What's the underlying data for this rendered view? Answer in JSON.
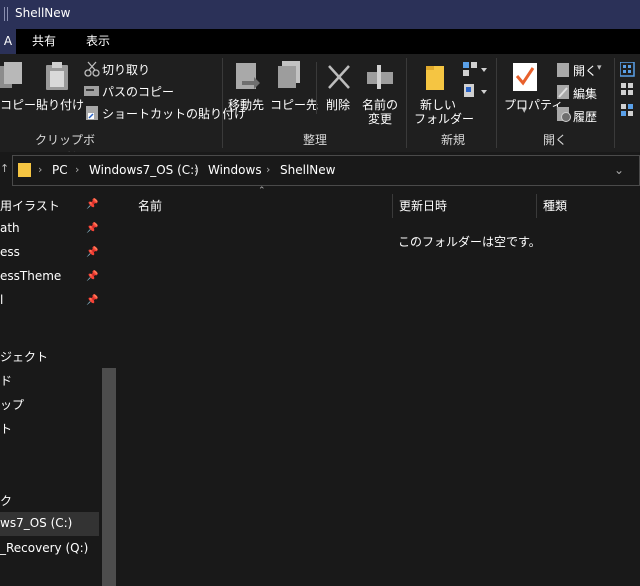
{
  "window": {
    "title": "ShellNew"
  },
  "tabs": {
    "file": "A",
    "share": "共有",
    "view": "表示"
  },
  "ribbon": {
    "clipboard": {
      "copy_label": "コピー",
      "paste_label": "貼り付け",
      "cut_label": "切り取り",
      "copy_path_label": "パスのコピー",
      "paste_shortcut_label": "ショートカットの貼り付け",
      "group_label": "クリップボード"
    },
    "organize": {
      "move_to_label": "移動先",
      "copy_to_label": "コピー先",
      "delete_label": "削除",
      "rename_line1": "名前の",
      "rename_line2": "変更",
      "group_label": "整理"
    },
    "new": {
      "new_folder_line1": "新しい",
      "new_folder_line2": "フォルダー",
      "group_label": "新規"
    },
    "open": {
      "properties_label": "プロパティ",
      "open_label": "開く",
      "edit_label": "編集",
      "history_label": "履歴",
      "group_label": "開く"
    }
  },
  "address": {
    "crumbs": [
      "PC",
      "Windows7_OS (C:)",
      "Windows",
      "ShellNew"
    ]
  },
  "nav": {
    "items": [
      {
        "label": "用イラスト",
        "pinned": true
      },
      {
        "label": "ath",
        "pinned": true
      },
      {
        "label": "ess",
        "pinned": true
      },
      {
        "label": "essTheme",
        "pinned": true
      },
      {
        "label": "l",
        "pinned": true
      },
      {
        "label": "ジェクト",
        "pinned": false
      },
      {
        "label": "ド",
        "pinned": false
      },
      {
        "label": "ップ",
        "pinned": false
      },
      {
        "label": "ト",
        "pinned": false
      },
      {
        "label": "ク",
        "pinned": false
      },
      {
        "label": "ws7_OS (C:)",
        "pinned": false,
        "selected": true
      },
      {
        "label": "_Recovery (Q:)",
        "pinned": false
      }
    ]
  },
  "content": {
    "columns": {
      "name": "名前",
      "modified": "更新日時",
      "type": "種類"
    },
    "empty_message": "このフォルダーは空です。"
  },
  "colors": {
    "titlebar": "#2b3158",
    "background": "#191919",
    "ribbon": "#1f1f1f",
    "check": "#e8602c",
    "folder": "#f5c542"
  }
}
